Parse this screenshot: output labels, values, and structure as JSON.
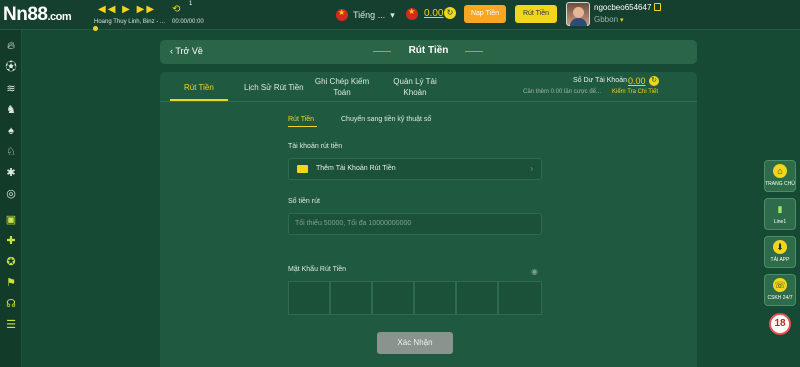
{
  "topbar": {
    "logo": "Nn88",
    "logo_suffix": ".com",
    "player": {
      "song": "Hoang Thuy Linh,  Binz - ...",
      "time": "00:00/00:00",
      "track_number": "1"
    },
    "language": "Tiếng ...",
    "balance": "0.00",
    "deposit_label": "Nạp Tiền",
    "withdraw_label": "Rút Tiền",
    "username": "ngocbeo654647",
    "level": "Gbbon"
  },
  "header": {
    "back_label": "Trở Về",
    "title": "Rút Tiền"
  },
  "tabs": [
    {
      "label": "Rút Tiền",
      "active": true
    },
    {
      "label": "Lịch Sử Rút Tiền",
      "active": false
    },
    {
      "label": "Ghi Chép Kiếm Toán",
      "active": false
    },
    {
      "label": "Quản Lý Tài Khoản",
      "active": false
    }
  ],
  "account_balance": {
    "label": "Số Dư Tài Khoản",
    "value": "0.00",
    "note": "Cần thêm 0.00 lần cược để...",
    "link": "Kiểm Tra Chi Tiết"
  },
  "subtabs": [
    {
      "label": "Rút Tiền",
      "active": true
    },
    {
      "label": "Chuyển sang tiền kỹ thuật số",
      "active": false
    }
  ],
  "form": {
    "account_label": "Tài khoản rút tiền",
    "add_account_label": "Thêm Tài Khoản Rút Tiền",
    "amount_label": "Số tiền rút",
    "amount_placeholder": "Tối thiểu 50000, Tối đa 10000000000",
    "password_label": "Mật Khẩu Rút Tiền",
    "submit_label": "Xác Nhận"
  },
  "right_float": [
    {
      "label": "TRANG CHỦ",
      "icon": "home-icon"
    },
    {
      "label": "Line1",
      "icon": "signal-icon"
    },
    {
      "label": "TẢI APP",
      "icon": "download-icon"
    },
    {
      "label": "CSKH 24/7",
      "icon": "support-icon"
    }
  ],
  "age_badge": "18",
  "colors": {
    "background": "#164a35",
    "accent": "#f2d51c",
    "deposit": "#f5a623",
    "panel": "#1f5a40"
  }
}
